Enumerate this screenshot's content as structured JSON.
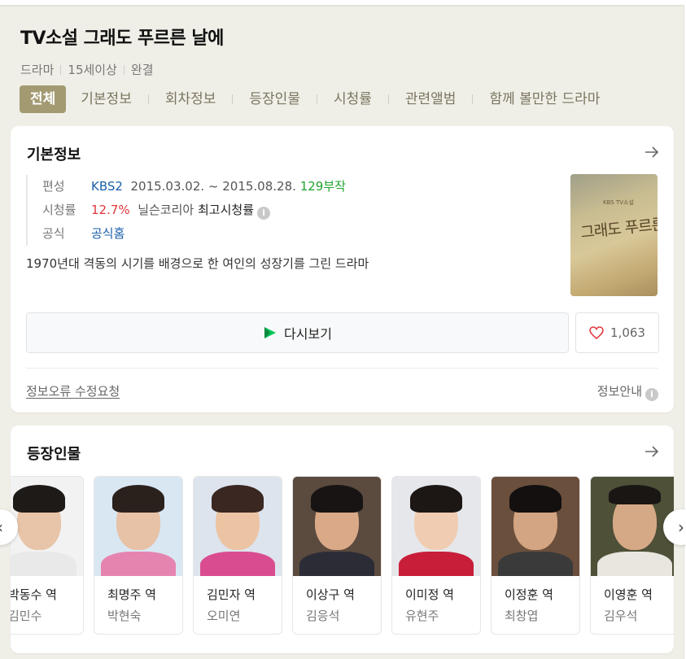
{
  "header": {
    "title": "TV소설 그래도 푸르른 날에",
    "meta": [
      "드라마",
      "15세이상",
      "완결"
    ]
  },
  "tabs": [
    "전체",
    "기본정보",
    "회차정보",
    "등장인물",
    "시청률",
    "관련앨범",
    "함께 볼만한 드라마"
  ],
  "basic": {
    "title": "기본정보",
    "rows": {
      "broadcast_label": "편성",
      "channel": "KBS2",
      "period": "2015.03.02. ~ 2015.08.28.",
      "episodes": "129부작",
      "rating_label": "시청률",
      "rating": "12.7%",
      "rating_source": "닐슨코리아",
      "rating_note": "최고시청률",
      "official_label": "공식",
      "official_link": "공식홈"
    },
    "description": "1970년대 격동의 시기를 배경으로 한 여인의 성장기를 그린 드라마",
    "poster_text": "그래도 푸르른 날에",
    "poster_small": "KBS TV소설",
    "watch_label": "다시보기",
    "like_count": "1,063",
    "report_label": "정보오류 수정요청",
    "guide_label": "정보안내"
  },
  "cast_section": {
    "title": "등장인물",
    "cast": [
      {
        "role": "박동수 역",
        "actor": "김민수"
      },
      {
        "role": "최명주 역",
        "actor": "박현숙"
      },
      {
        "role": "김민자 역",
        "actor": "오미연"
      },
      {
        "role": "이상구 역",
        "actor": "김응석"
      },
      {
        "role": "이미정 역",
        "actor": "유현주"
      },
      {
        "role": "이정훈 역",
        "actor": "최창엽"
      },
      {
        "role": "이영훈 역",
        "actor": "김우석"
      }
    ]
  },
  "colors": {
    "accent_tab": "#a39a72",
    "link_blue": "#1a5fa8",
    "rating_red": "#e0363c",
    "episodes_green": "#1fa32d"
  }
}
